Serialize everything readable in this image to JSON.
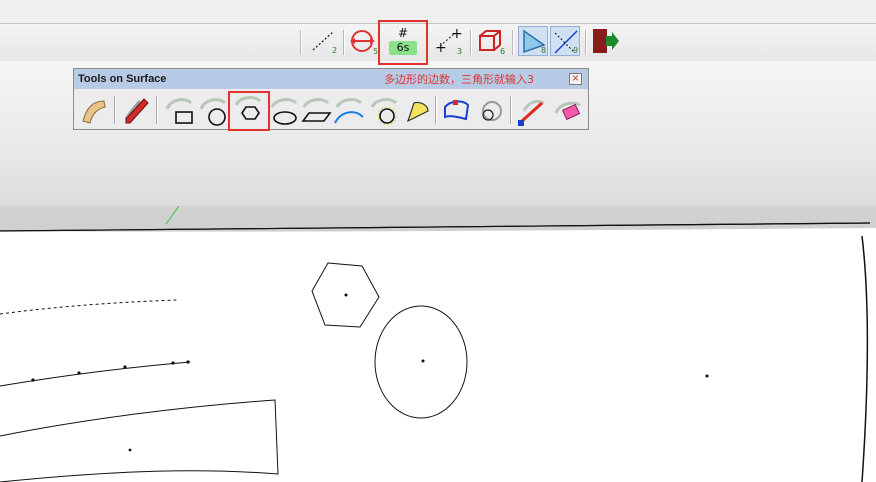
{
  "toolbar": {
    "dimensions_hash": "#",
    "dimensions_value": "6s",
    "icons": [
      "line-icon",
      "move-arrows-icon",
      "dimension-hash-icon",
      "add-point-icon",
      "box-icon",
      "triangle-icon",
      "axis-icon",
      "exit-icon"
    ],
    "badges": {
      "line": "2",
      "move": "5",
      "point": "3",
      "box": "6",
      "triangle": "8",
      "axis": "9"
    }
  },
  "panel": {
    "title": "Tools on Surface",
    "close_label": "×",
    "annotation": "多边形的边数，三角形就输入3",
    "tools": [
      "surface-icon",
      "pencil-icon",
      "rectangle-icon",
      "circle-icon",
      "polygon-icon",
      "ellipse-icon",
      "parallelogram-icon",
      "arc-icon",
      "circle-offset-icon",
      "pie-icon",
      "offset-icon",
      "rotate-icon",
      "line-draw-icon",
      "eraser-icon"
    ]
  },
  "colors": {
    "highlight": "#e0332e",
    "title_bar": "#b8cbe6",
    "value_bg": "#8be08b"
  }
}
